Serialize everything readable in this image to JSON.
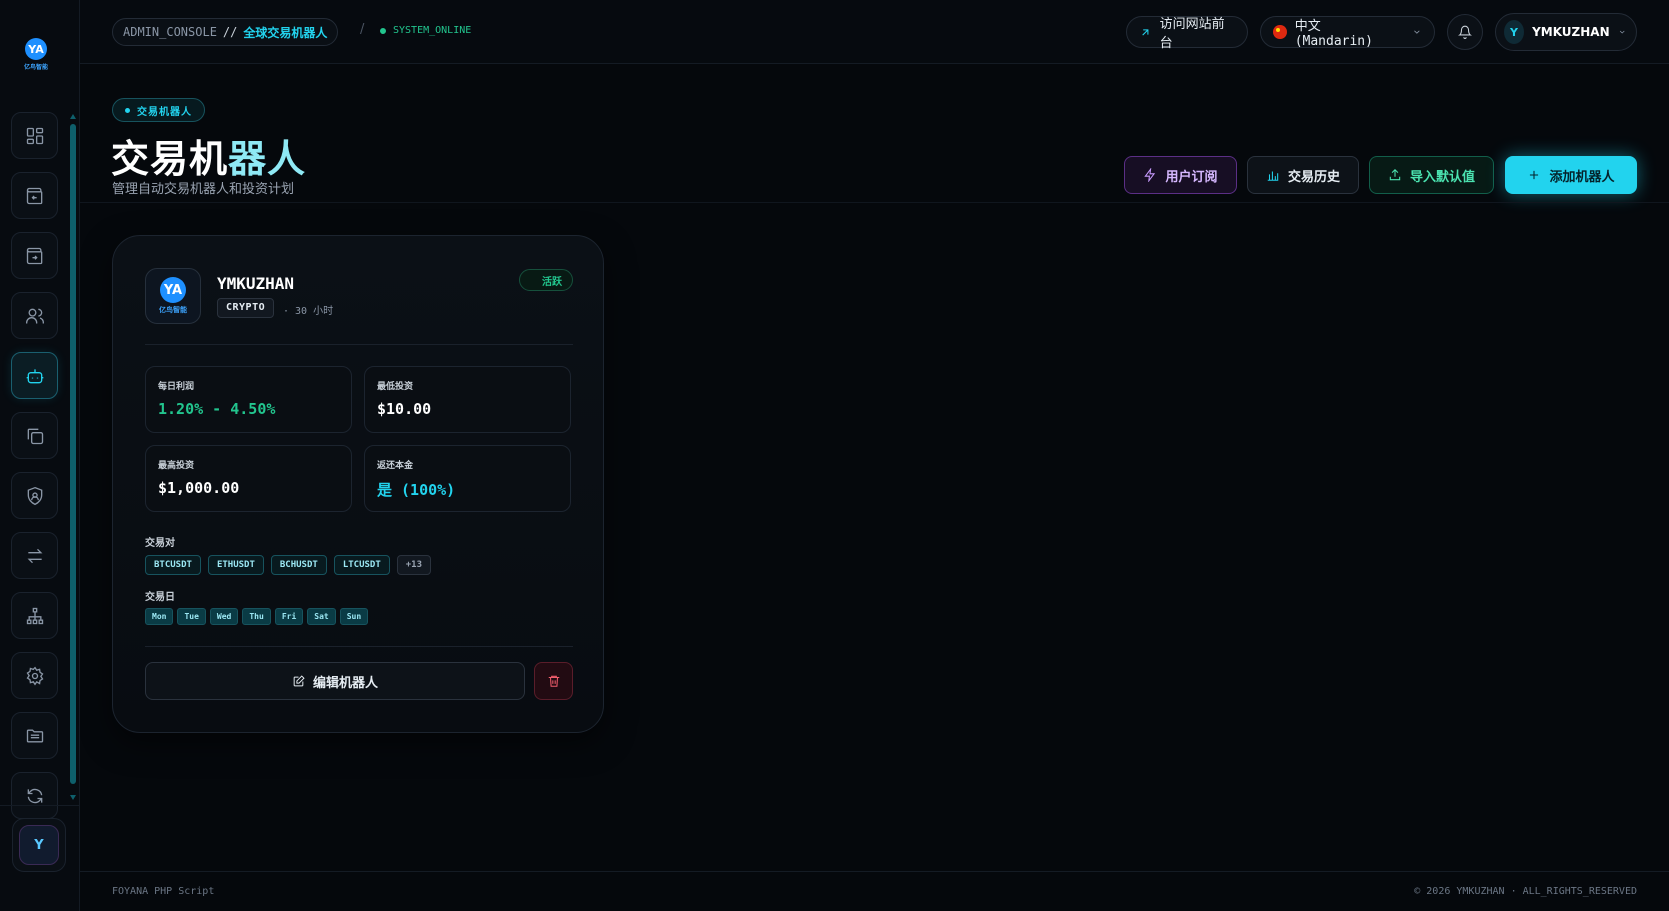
{
  "brand": {
    "logo_text": "亿鸟智能",
    "logo_mark": "YA"
  },
  "header": {
    "crumb_root": "ADMIN_CONSOLE",
    "crumb_sep": "//",
    "crumb_current": "全球交易机器人",
    "path_sep": "/",
    "status": "SYSTEM_ONLINE",
    "visit_label": "访问网站前台",
    "language_label": "中文 (Mandarin)",
    "user_initial": "Y",
    "user_name": "YMKUZHAN"
  },
  "page": {
    "badge": "交易机器人",
    "title_main": "交易机",
    "title_accent": "器人",
    "subtitle": "管理自动交易机器人和投资计划"
  },
  "actions": {
    "subscriptions": "用户订阅",
    "history": "交易历史",
    "import_defaults": "导入默认值",
    "add_bot": "添加机器人"
  },
  "sidebar": {
    "items": [
      {
        "icon": "dashboard-icon"
      },
      {
        "icon": "wallet-in-icon"
      },
      {
        "icon": "wallet-out-icon"
      },
      {
        "icon": "users-icon"
      },
      {
        "icon": "robot-icon",
        "active": true
      },
      {
        "icon": "copy-icon"
      },
      {
        "icon": "shield-icon"
      },
      {
        "icon": "transfer-icon"
      },
      {
        "icon": "network-icon"
      },
      {
        "icon": "gear-icon"
      },
      {
        "icon": "folder-icon"
      },
      {
        "icon": "refresh-icon"
      }
    ],
    "avatar_initial": "Y"
  },
  "bot": {
    "name": "YMKUZHAN",
    "category": "CRYPTO",
    "duration": "· 30 小时",
    "status": "活跃",
    "stats": {
      "daily_profit_label": "每日利润",
      "daily_profit": "1.20% - 4.50%",
      "min_invest_label": "最低投资",
      "min_invest": "$10.00",
      "max_invest_label": "最高投资",
      "max_invest": "$1,000.00",
      "return_capital_label": "返还本金",
      "return_capital": "是 (100%)"
    },
    "pairs_label": "交易对",
    "pairs": [
      "BTCUSDT",
      "ETHUSDT",
      "BCHUSDT",
      "LTCUSDT"
    ],
    "pairs_more": "+13",
    "days_label": "交易日",
    "days": [
      "Mon",
      "Tue",
      "Wed",
      "Thu",
      "Fri",
      "Sat",
      "Sun"
    ],
    "edit_label": "编辑机器人"
  },
  "footer": {
    "left": "FOYANA PHP Script",
    "right": "© 2026 YMKUZHAN · ALL_RIGHTS_RESERVED"
  }
}
